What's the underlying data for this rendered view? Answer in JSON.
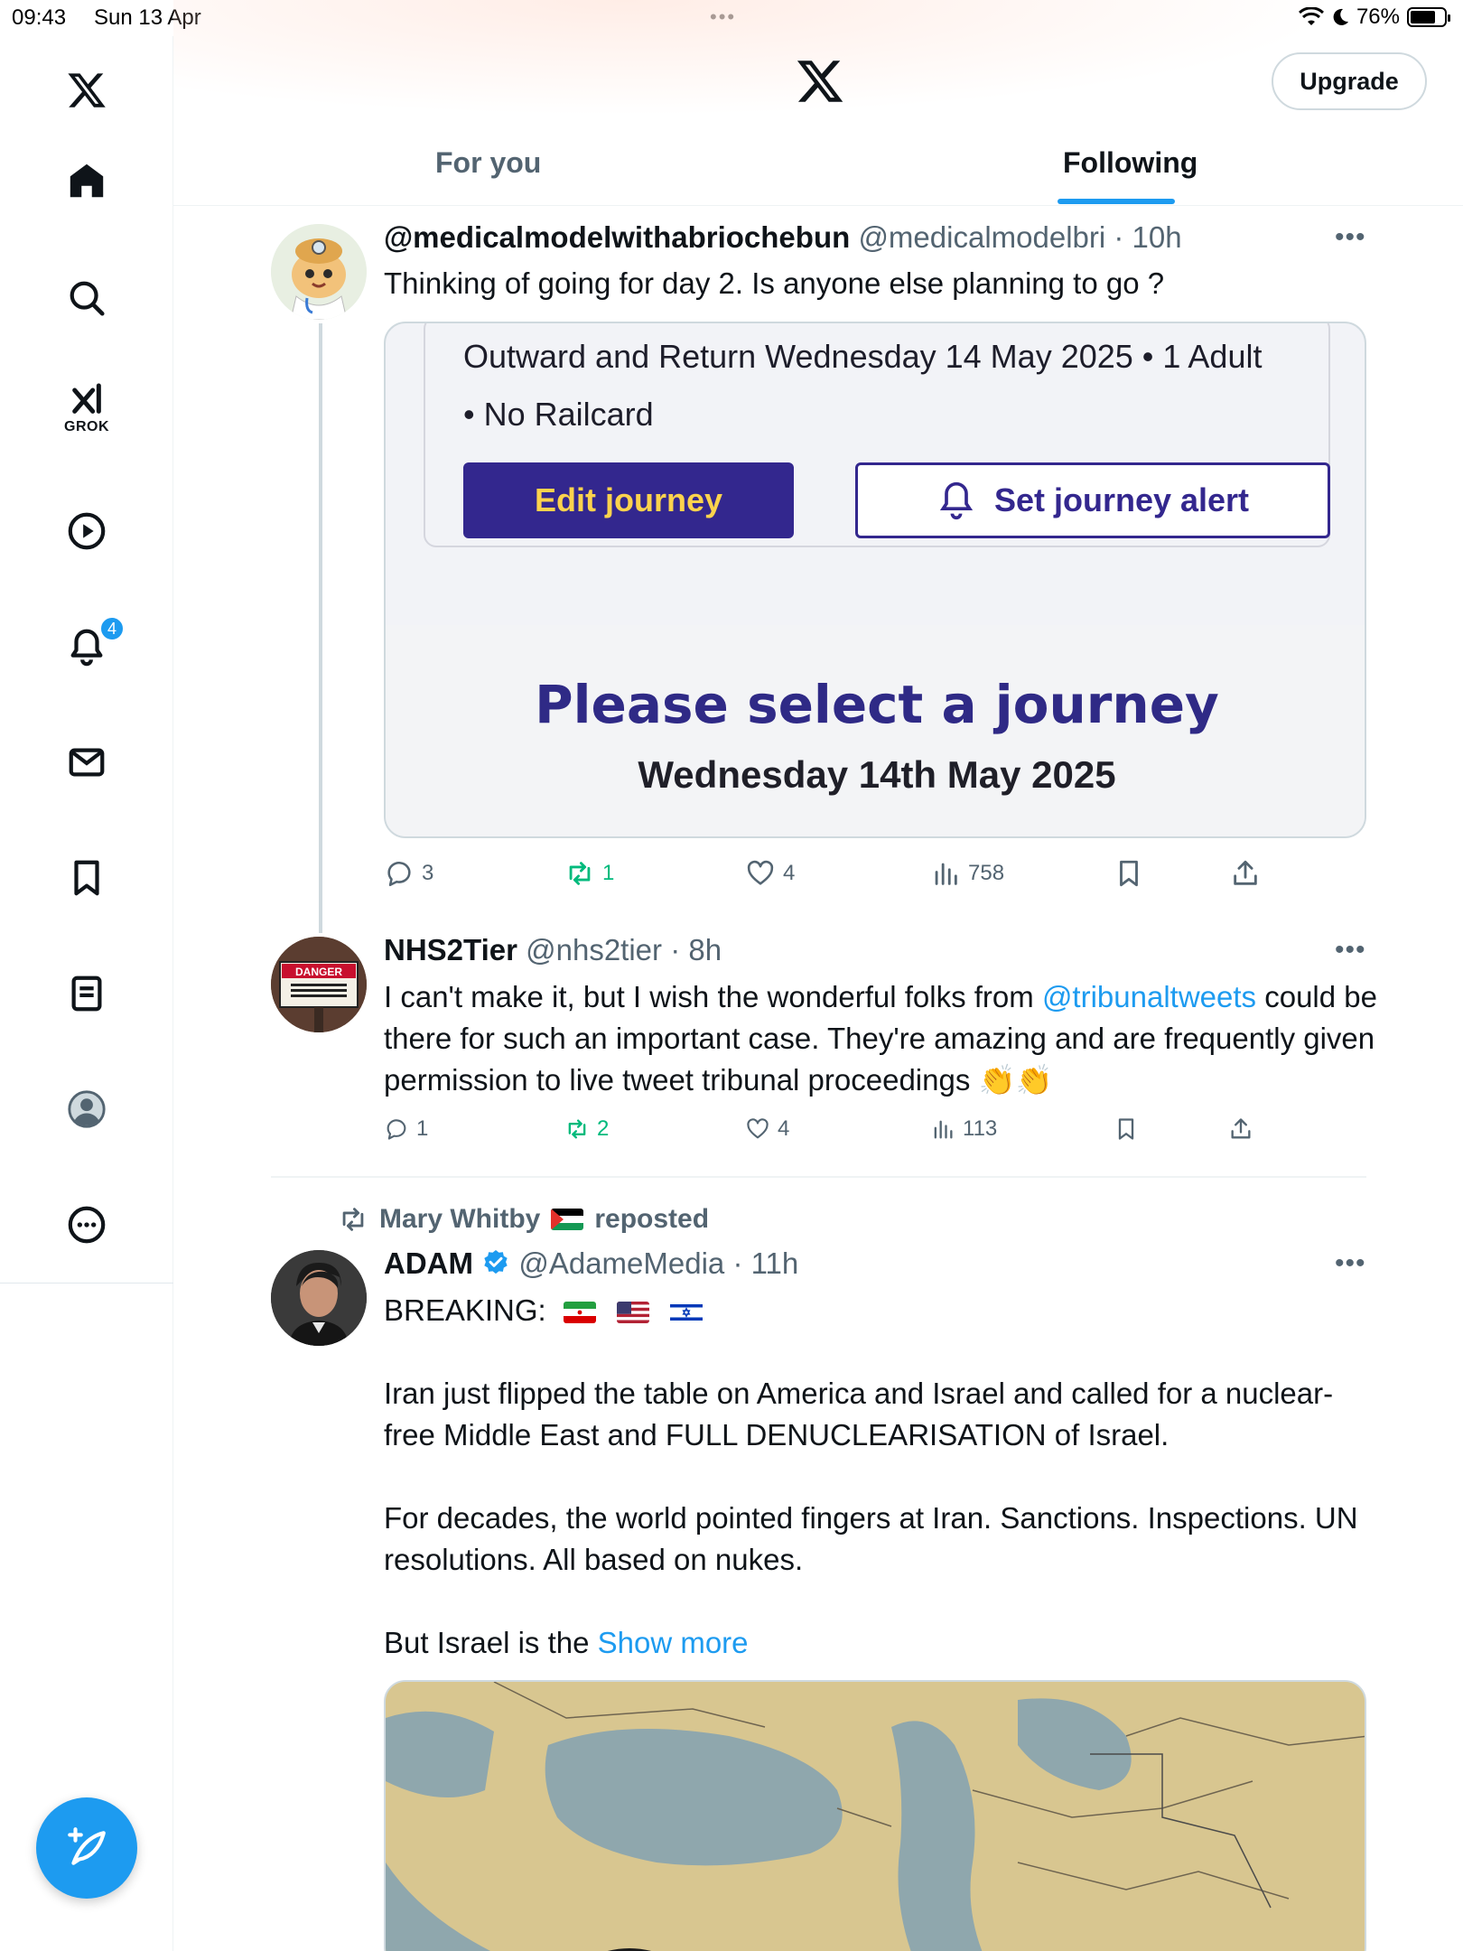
{
  "status_bar": {
    "time": "09:43",
    "date": "Sun 13 Apr",
    "dots": "•••",
    "battery": "76%",
    "battery_level": 0.76
  },
  "header": {
    "upgrade_label": "Upgrade"
  },
  "tabs": [
    {
      "label": "For you"
    },
    {
      "label": "Following"
    }
  ],
  "sidebar": {
    "grok_label": "GROK",
    "notifications_count": "4"
  },
  "posts": [
    {
      "name": "@medicalmodelwithabriochebun",
      "handle": "@medicalmodelbri",
      "time": "· 10h",
      "text": "Thinking of going for day 2. Is anyone else planning to go ?",
      "media": {
        "line1": "Outward and Return Wednesday 14 May 2025 • 1 Adult",
        "line2": "• No Railcard",
        "edit_label": "Edit journey",
        "alert_label": "Set journey alert",
        "title": "Please select a journey",
        "date": "Wednesday 14th May 2025"
      },
      "replies": "3",
      "reposts": "1",
      "likes": "4",
      "views": "758"
    },
    {
      "name": "NHS2Tier",
      "handle": "@nhs2tier",
      "time": "· 8h",
      "text_before": "I can't make it, but I wish the wonderful folks from ",
      "mention": "@tribunaltweets",
      "text_after": " could be there for such an important case. They're amazing and are frequently given permission to live tweet tribunal proceedings 👏👏",
      "avatar_sign": "DANGER",
      "replies": "1",
      "reposts": "2",
      "likes": "4",
      "views": "113"
    },
    {
      "repost_by": "Mary Whitby",
      "repost_label": "reposted",
      "name": "ADAM",
      "handle": "@AdameMedia",
      "time": "· 11h",
      "breaking": "BREAKING:",
      "para1": "Iran just flipped the table on America and Israel and called for a nuclear-free Middle East and FULL DENUCLEARISATION of Israel.",
      "para2": "For decades, the world pointed fingers at Iran. Sanctions. Inspections. UN resolutions. All based on nukes.",
      "para3": "But Israel is the",
      "show_more": "Show more"
    }
  ],
  "colors": {
    "accent": "#1d9bf0",
    "repost_green": "#00ba7c",
    "journey_purple": "#33278e",
    "journey_yellow": "#fcd34d"
  }
}
